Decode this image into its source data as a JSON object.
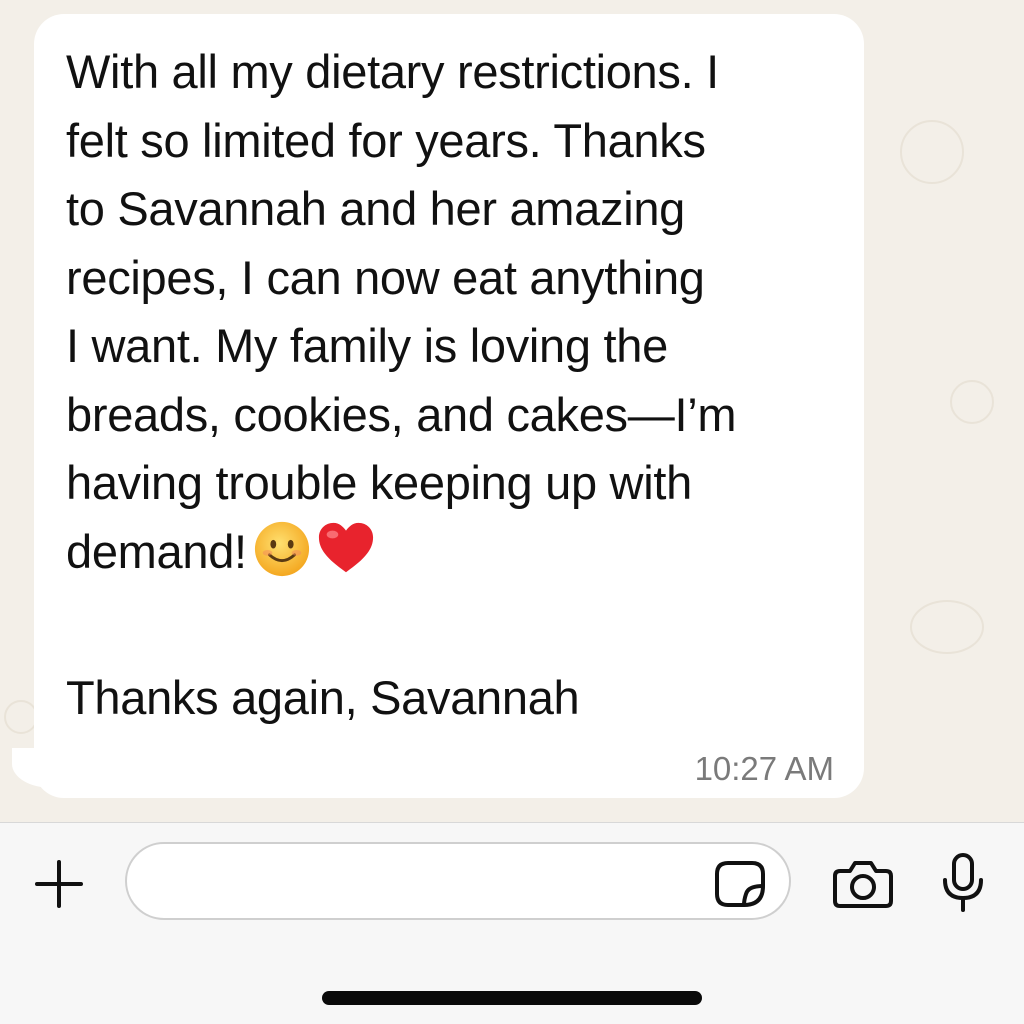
{
  "message": {
    "lines": [
      "With all my dietary restrictions. I",
      "felt so limited for years. Thanks",
      "to Savannah and her amazing",
      "recipes, I can now eat anything",
      "I want. My family is loving the",
      "breads, cookies, and cakes—I’m",
      "having trouble keeping up with",
      "demand!"
    ],
    "emojis": [
      "smiling-face-emoji",
      "red-heart-emoji"
    ],
    "signoff": "Thanks again, Savannah",
    "time": "10:27 AM"
  },
  "composer": {
    "input_value": "",
    "input_placeholder": "",
    "icons": [
      "plus-icon",
      "sticker-icon",
      "camera-icon",
      "microphone-icon"
    ]
  },
  "colors": {
    "chat_background": "#f3efe8",
    "bubble": "#ffffff",
    "text": "#111111",
    "timestamp": "#7a7a7a",
    "composer_background": "#f7f7f7"
  }
}
